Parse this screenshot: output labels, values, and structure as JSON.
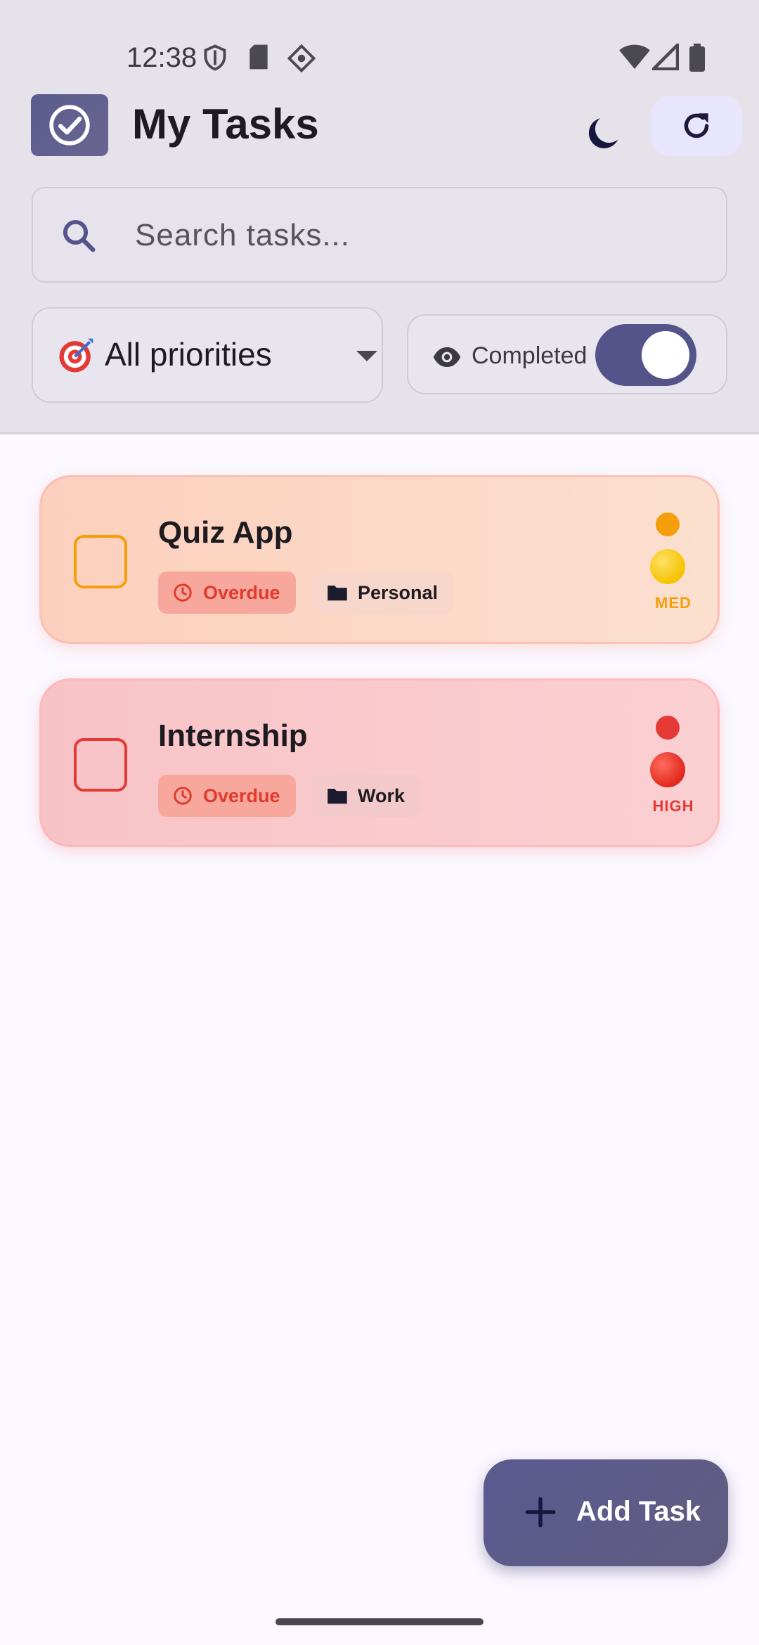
{
  "status_bar": {
    "time": "12:38"
  },
  "header": {
    "title": "My Tasks"
  },
  "search": {
    "placeholder": "Search tasks..."
  },
  "filters": {
    "priority_label": "All priorities",
    "completed_label": "Completed",
    "completed_toggle_on": true
  },
  "tasks": [
    {
      "title": "Quiz App",
      "status": "Overdue",
      "category": "Personal",
      "priority": "MED",
      "priority_color": "#f59e0b"
    },
    {
      "title": "Internship",
      "status": "Overdue",
      "category": "Work",
      "priority": "HIGH",
      "priority_color": "#e53935"
    }
  ],
  "fab": {
    "label": "Add Task"
  },
  "colors": {
    "accent": "#55548a",
    "overdue": "#e03b2f"
  }
}
